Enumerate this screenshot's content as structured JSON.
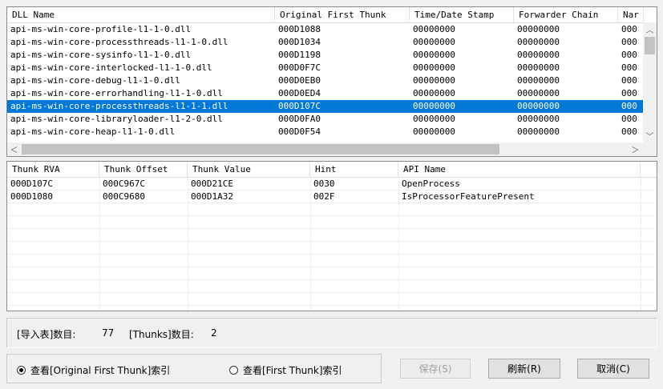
{
  "dll_table": {
    "columns": [
      "DLL Name",
      "Original First Thunk",
      "Time/Date Stamp",
      "Forwarder Chain",
      "Nar"
    ],
    "rows": [
      [
        "api-ms-win-core-profile-l1-1-0.dll",
        "000D1088",
        "00000000",
        "00000000",
        "000"
      ],
      [
        "api-ms-win-core-processthreads-l1-1-0.dll",
        "000D1034",
        "00000000",
        "00000000",
        "000"
      ],
      [
        "api-ms-win-core-sysinfo-l1-1-0.dll",
        "000D1198",
        "00000000",
        "00000000",
        "000"
      ],
      [
        "api-ms-win-core-interlocked-l1-1-0.dll",
        "000D0F7C",
        "00000000",
        "00000000",
        "000"
      ],
      [
        "api-ms-win-core-debug-l1-1-0.dll",
        "000D0EB0",
        "00000000",
        "00000000",
        "000"
      ],
      [
        "api-ms-win-core-errorhandling-l1-1-0.dll",
        "000D0ED4",
        "00000000",
        "00000000",
        "000"
      ],
      [
        "api-ms-win-core-processthreads-l1-1-1.dll",
        "000D107C",
        "00000000",
        "00000000",
        "000"
      ],
      [
        "api-ms-win-core-libraryloader-l1-2-0.dll",
        "000D0FA0",
        "00000000",
        "00000000",
        "000"
      ],
      [
        "api-ms-win-core-heap-l1-1-0.dll",
        "000D0F54",
        "00000000",
        "00000000",
        "000"
      ]
    ],
    "selected_row": 6
  },
  "thunk_table": {
    "columns": [
      "Thunk RVA",
      "Thunk Offset",
      "Thunk Value",
      "Hint",
      "API Name"
    ],
    "rows": [
      [
        "000D107C",
        "000C967C",
        "000D21CE",
        "0030",
        "OpenProcess"
      ],
      [
        "000D1080",
        "000C9680",
        "000D1A32",
        "002F",
        "IsProcessorFeaturePresent"
      ]
    ]
  },
  "status": {
    "imports_label": "[导入表]数目:",
    "imports_count": "77",
    "thunks_label": "[Thunks]数目:",
    "thunks_count": "2"
  },
  "mode": {
    "original_label": "查看[Original First Thunk]索引",
    "first_label": "查看[First Thunk]索引",
    "selected": "original"
  },
  "buttons": {
    "save": "保存(S)",
    "refresh": "刷新(R)",
    "cancel": "取消(C)"
  },
  "icons": {
    "up": "▲-icon",
    "down": "▼-icon",
    "left": "◀-icon",
    "right": "▶-icon"
  }
}
